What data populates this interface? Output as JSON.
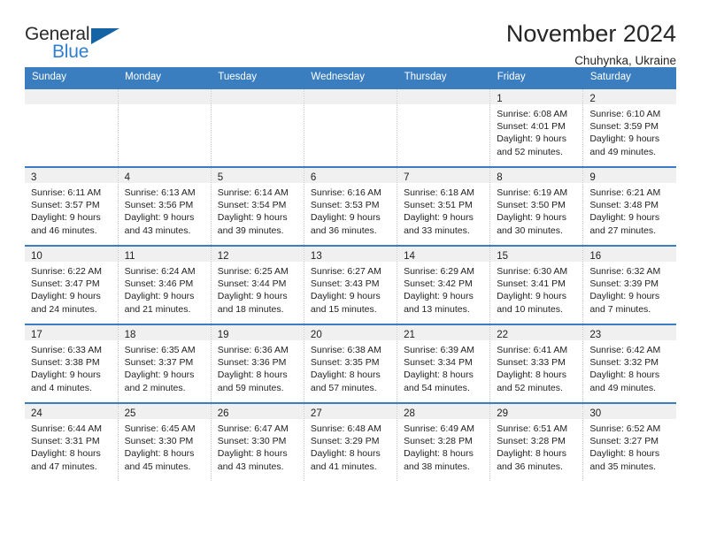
{
  "logo": {
    "word_one": "General",
    "word_two": "Blue",
    "triangle_icon": "blue-triangle-icon",
    "brand_blue": "#2f7fd1",
    "triangle_color": "#1464a5"
  },
  "header": {
    "title": "November 2024",
    "subtitle": "Chuhynka, Ukraine"
  },
  "theme": {
    "header_blue": "#3b7ec0",
    "daynum_band": "#f0f0f0",
    "text": "#1f1f1f"
  },
  "weekdays": [
    "Sunday",
    "Monday",
    "Tuesday",
    "Wednesday",
    "Thursday",
    "Friday",
    "Saturday"
  ],
  "weeks": [
    [
      {
        "day": ""
      },
      {
        "day": ""
      },
      {
        "day": ""
      },
      {
        "day": ""
      },
      {
        "day": ""
      },
      {
        "day": "1",
        "sunrise": "Sunrise: 6:08 AM",
        "sunset": "Sunset: 4:01 PM",
        "daylight_1": "Daylight: 9 hours",
        "daylight_2": "and 52 minutes."
      },
      {
        "day": "2",
        "sunrise": "Sunrise: 6:10 AM",
        "sunset": "Sunset: 3:59 PM",
        "daylight_1": "Daylight: 9 hours",
        "daylight_2": "and 49 minutes."
      }
    ],
    [
      {
        "day": "3",
        "sunrise": "Sunrise: 6:11 AM",
        "sunset": "Sunset: 3:57 PM",
        "daylight_1": "Daylight: 9 hours",
        "daylight_2": "and 46 minutes."
      },
      {
        "day": "4",
        "sunrise": "Sunrise: 6:13 AM",
        "sunset": "Sunset: 3:56 PM",
        "daylight_1": "Daylight: 9 hours",
        "daylight_2": "and 43 minutes."
      },
      {
        "day": "5",
        "sunrise": "Sunrise: 6:14 AM",
        "sunset": "Sunset: 3:54 PM",
        "daylight_1": "Daylight: 9 hours",
        "daylight_2": "and 39 minutes."
      },
      {
        "day": "6",
        "sunrise": "Sunrise: 6:16 AM",
        "sunset": "Sunset: 3:53 PM",
        "daylight_1": "Daylight: 9 hours",
        "daylight_2": "and 36 minutes."
      },
      {
        "day": "7",
        "sunrise": "Sunrise: 6:18 AM",
        "sunset": "Sunset: 3:51 PM",
        "daylight_1": "Daylight: 9 hours",
        "daylight_2": "and 33 minutes."
      },
      {
        "day": "8",
        "sunrise": "Sunrise: 6:19 AM",
        "sunset": "Sunset: 3:50 PM",
        "daylight_1": "Daylight: 9 hours",
        "daylight_2": "and 30 minutes."
      },
      {
        "day": "9",
        "sunrise": "Sunrise: 6:21 AM",
        "sunset": "Sunset: 3:48 PM",
        "daylight_1": "Daylight: 9 hours",
        "daylight_2": "and 27 minutes."
      }
    ],
    [
      {
        "day": "10",
        "sunrise": "Sunrise: 6:22 AM",
        "sunset": "Sunset: 3:47 PM",
        "daylight_1": "Daylight: 9 hours",
        "daylight_2": "and 24 minutes."
      },
      {
        "day": "11",
        "sunrise": "Sunrise: 6:24 AM",
        "sunset": "Sunset: 3:46 PM",
        "daylight_1": "Daylight: 9 hours",
        "daylight_2": "and 21 minutes."
      },
      {
        "day": "12",
        "sunrise": "Sunrise: 6:25 AM",
        "sunset": "Sunset: 3:44 PM",
        "daylight_1": "Daylight: 9 hours",
        "daylight_2": "and 18 minutes."
      },
      {
        "day": "13",
        "sunrise": "Sunrise: 6:27 AM",
        "sunset": "Sunset: 3:43 PM",
        "daylight_1": "Daylight: 9 hours",
        "daylight_2": "and 15 minutes."
      },
      {
        "day": "14",
        "sunrise": "Sunrise: 6:29 AM",
        "sunset": "Sunset: 3:42 PM",
        "daylight_1": "Daylight: 9 hours",
        "daylight_2": "and 13 minutes."
      },
      {
        "day": "15",
        "sunrise": "Sunrise: 6:30 AM",
        "sunset": "Sunset: 3:41 PM",
        "daylight_1": "Daylight: 9 hours",
        "daylight_2": "and 10 minutes."
      },
      {
        "day": "16",
        "sunrise": "Sunrise: 6:32 AM",
        "sunset": "Sunset: 3:39 PM",
        "daylight_1": "Daylight: 9 hours",
        "daylight_2": "and 7 minutes."
      }
    ],
    [
      {
        "day": "17",
        "sunrise": "Sunrise: 6:33 AM",
        "sunset": "Sunset: 3:38 PM",
        "daylight_1": "Daylight: 9 hours",
        "daylight_2": "and 4 minutes."
      },
      {
        "day": "18",
        "sunrise": "Sunrise: 6:35 AM",
        "sunset": "Sunset: 3:37 PM",
        "daylight_1": "Daylight: 9 hours",
        "daylight_2": "and 2 minutes."
      },
      {
        "day": "19",
        "sunrise": "Sunrise: 6:36 AM",
        "sunset": "Sunset: 3:36 PM",
        "daylight_1": "Daylight: 8 hours",
        "daylight_2": "and 59 minutes."
      },
      {
        "day": "20",
        "sunrise": "Sunrise: 6:38 AM",
        "sunset": "Sunset: 3:35 PM",
        "daylight_1": "Daylight: 8 hours",
        "daylight_2": "and 57 minutes."
      },
      {
        "day": "21",
        "sunrise": "Sunrise: 6:39 AM",
        "sunset": "Sunset: 3:34 PM",
        "daylight_1": "Daylight: 8 hours",
        "daylight_2": "and 54 minutes."
      },
      {
        "day": "22",
        "sunrise": "Sunrise: 6:41 AM",
        "sunset": "Sunset: 3:33 PM",
        "daylight_1": "Daylight: 8 hours",
        "daylight_2": "and 52 minutes."
      },
      {
        "day": "23",
        "sunrise": "Sunrise: 6:42 AM",
        "sunset": "Sunset: 3:32 PM",
        "daylight_1": "Daylight: 8 hours",
        "daylight_2": "and 49 minutes."
      }
    ],
    [
      {
        "day": "24",
        "sunrise": "Sunrise: 6:44 AM",
        "sunset": "Sunset: 3:31 PM",
        "daylight_1": "Daylight: 8 hours",
        "daylight_2": "and 47 minutes."
      },
      {
        "day": "25",
        "sunrise": "Sunrise: 6:45 AM",
        "sunset": "Sunset: 3:30 PM",
        "daylight_1": "Daylight: 8 hours",
        "daylight_2": "and 45 minutes."
      },
      {
        "day": "26",
        "sunrise": "Sunrise: 6:47 AM",
        "sunset": "Sunset: 3:30 PM",
        "daylight_1": "Daylight: 8 hours",
        "daylight_2": "and 43 minutes."
      },
      {
        "day": "27",
        "sunrise": "Sunrise: 6:48 AM",
        "sunset": "Sunset: 3:29 PM",
        "daylight_1": "Daylight: 8 hours",
        "daylight_2": "and 41 minutes."
      },
      {
        "day": "28",
        "sunrise": "Sunrise: 6:49 AM",
        "sunset": "Sunset: 3:28 PM",
        "daylight_1": "Daylight: 8 hours",
        "daylight_2": "and 38 minutes."
      },
      {
        "day": "29",
        "sunrise": "Sunrise: 6:51 AM",
        "sunset": "Sunset: 3:28 PM",
        "daylight_1": "Daylight: 8 hours",
        "daylight_2": "and 36 minutes."
      },
      {
        "day": "30",
        "sunrise": "Sunrise: 6:52 AM",
        "sunset": "Sunset: 3:27 PM",
        "daylight_1": "Daylight: 8 hours",
        "daylight_2": "and 35 minutes."
      }
    ]
  ]
}
